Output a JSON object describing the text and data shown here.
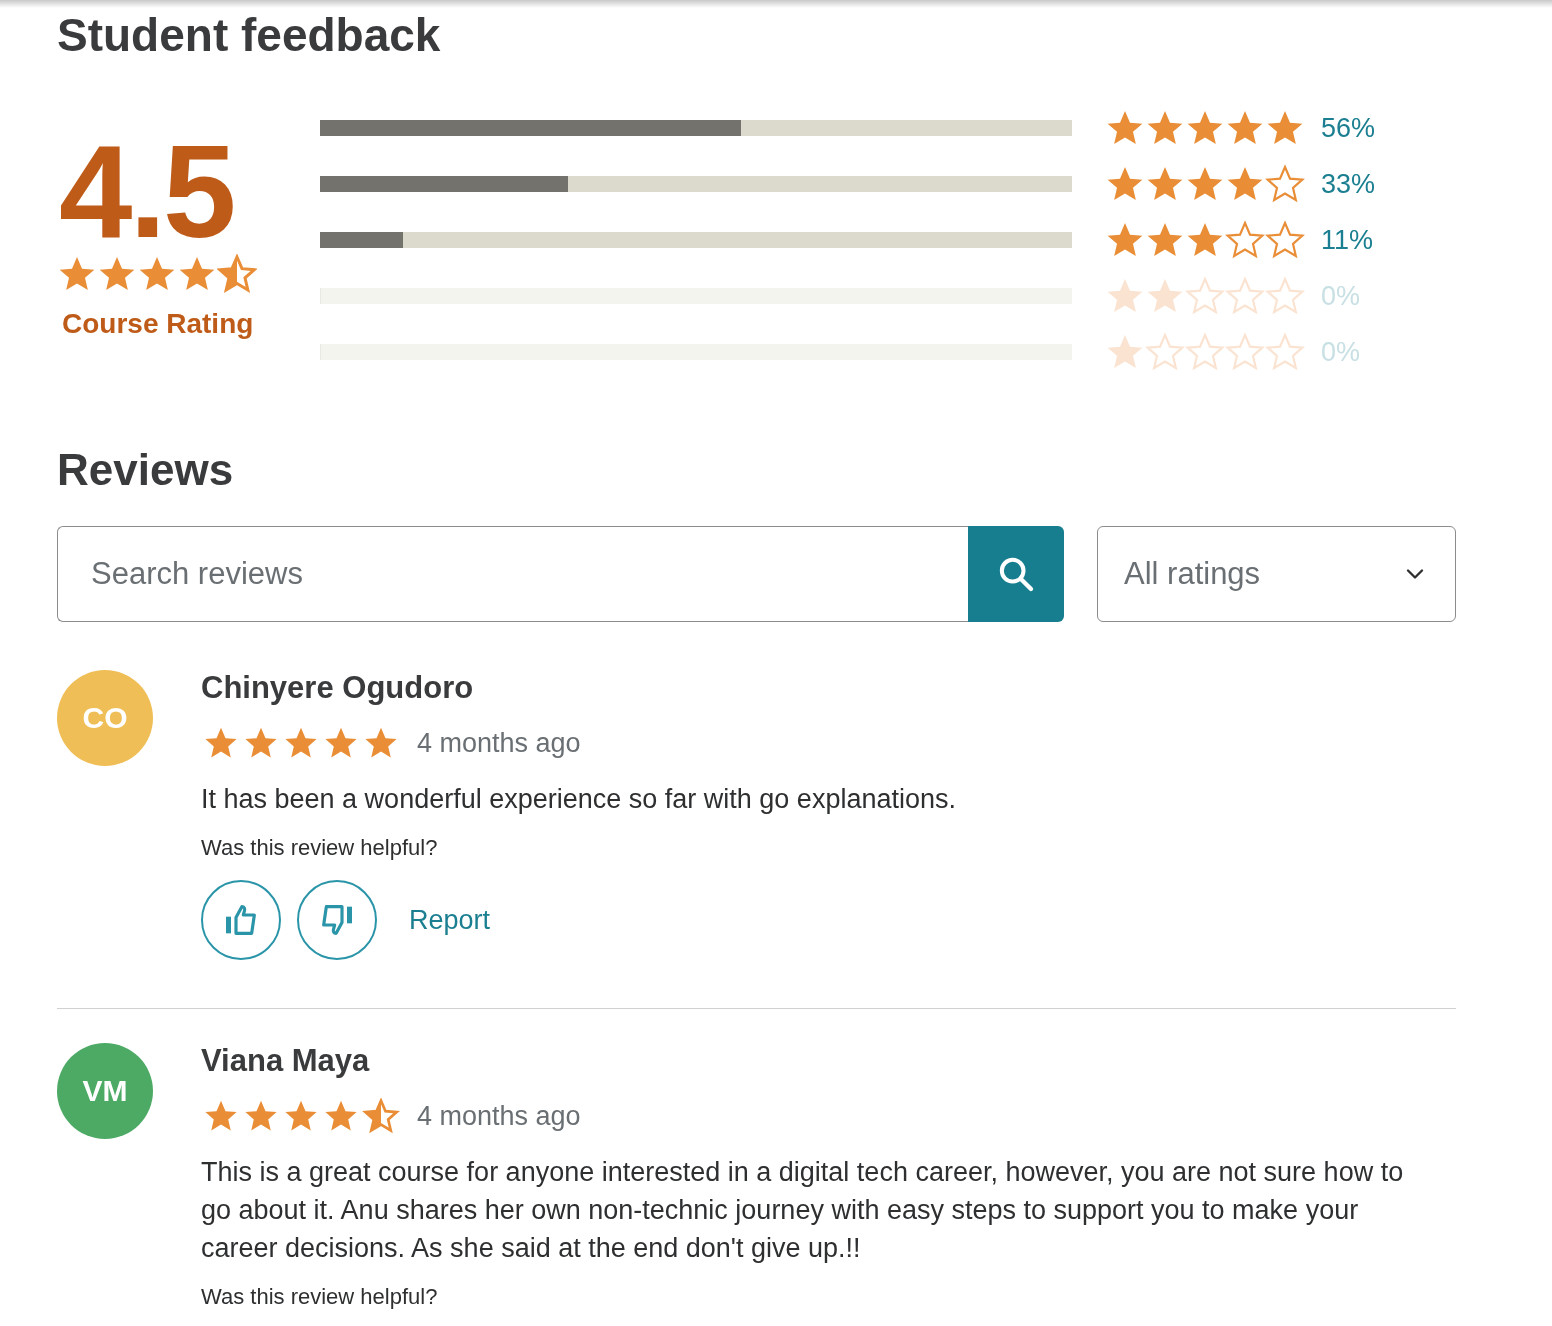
{
  "title": "Student feedback",
  "summary": {
    "rating": "4.5",
    "stars": 4.5,
    "label": "Course Rating"
  },
  "distribution": [
    {
      "level": 0.56,
      "stars": 5,
      "reading": "56%"
    },
    {
      "level": 0.33,
      "stars": 4,
      "reading": "33%"
    },
    {
      "level": 0.11,
      "stars": 3,
      "reading": "11%"
    },
    {
      "level": 0,
      "stars": 2,
      "reading": "0%"
    },
    {
      "level": 0,
      "stars": 1,
      "reading": "0%"
    }
  ],
  "reviews_heading": "Reviews",
  "search": {
    "placeholder": "Search reviews"
  },
  "filter": {
    "value": "All ratings"
  },
  "reviews": [
    {
      "initials": "CO",
      "color": "#efbe56",
      "name": "Chinyere Ogudoro",
      "stars": 5,
      "time": "4 months ago",
      "text": "It has been a wonderful experience so far with go explanations.",
      "helpful_prompt": "Was this review helpful?",
      "report": "Report"
    },
    {
      "initials": "VM",
      "color": "#4caa65",
      "name": "Viana Maya",
      "stars": 4.5,
      "time": "4 months ago",
      "text": "This is a great course for anyone interested in a digital tech career, however, you are not sure how to go about it. Anu shares her own non-technic journey with easy steps to support you to make your career decisions. As she said at the end don't give up.!!",
      "helpful_prompt": "Was this review helpful?"
    }
  ]
}
